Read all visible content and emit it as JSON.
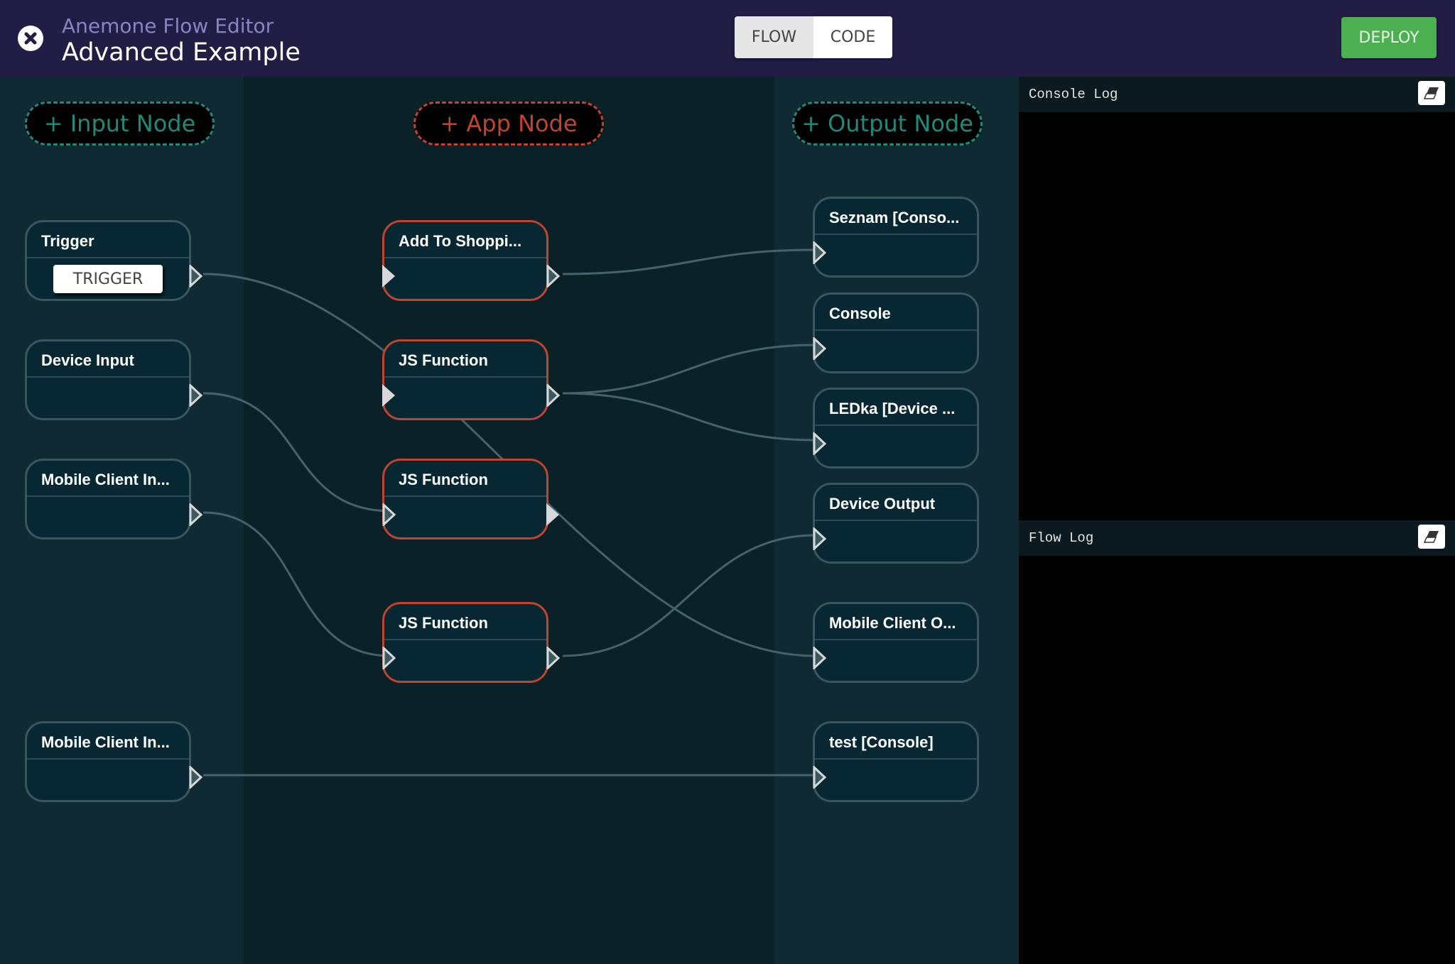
{
  "header": {
    "app_name": "Anemone Flow Editor",
    "flow_title": "Advanced Example",
    "close_icon": "close-circle-icon",
    "view_toggle": [
      {
        "label": "FLOW",
        "active": true
      },
      {
        "label": "CODE",
        "active": false
      }
    ],
    "deploy_label": "DEPLOY"
  },
  "colors": {
    "header_bg": "#221d45",
    "input_accent": "#1f8a7a",
    "app_accent": "#c0442e",
    "deploy_green": "#4caf50"
  },
  "columns": {
    "input": {
      "add_label": "+ Input Node",
      "nodes": [
        {
          "id": "trigger",
          "title": "Trigger",
          "button": "TRIGGER"
        },
        {
          "id": "device-input",
          "title": "Device Input"
        },
        {
          "id": "mobile-in-1",
          "title": "Mobile Client In..."
        },
        {
          "id": "mobile-in-2",
          "title": "Mobile Client In..."
        }
      ]
    },
    "app": {
      "add_label": "+ App Node",
      "nodes": [
        {
          "id": "add-to-shopping",
          "title": "Add To Shoppi..."
        },
        {
          "id": "js-1",
          "title": "JS Function"
        },
        {
          "id": "js-2",
          "title": "JS Function"
        },
        {
          "id": "js-3",
          "title": "JS Function"
        }
      ]
    },
    "output": {
      "add_label": "+ Output Node",
      "nodes": [
        {
          "id": "seznam",
          "title": "Seznam [Conso..."
        },
        {
          "id": "console",
          "title": "Console"
        },
        {
          "id": "ledka",
          "title": "LEDka [Device ..."
        },
        {
          "id": "device-output",
          "title": "Device Output"
        },
        {
          "id": "mobile-out",
          "title": "Mobile Client O..."
        },
        {
          "id": "test-console",
          "title": "test [Console]"
        }
      ]
    }
  },
  "connections": [
    {
      "from": "trigger",
      "to": "mobile-out"
    },
    {
      "from": "device-input",
      "to": "js-2"
    },
    {
      "from": "mobile-in-1",
      "to": "js-3"
    },
    {
      "from": "mobile-in-2",
      "to": "test-console"
    },
    {
      "from": "add-to-shopping",
      "to": "seznam"
    },
    {
      "from": "js-1",
      "to": "console"
    },
    {
      "from": "js-1",
      "to": "ledka"
    },
    {
      "from": "js-3",
      "to": "device-output"
    }
  ],
  "logs": {
    "console_log": {
      "label": "Console Log",
      "clear_icon": "eraser-icon"
    },
    "flow_log": {
      "label": "Flow Log",
      "clear_icon": "eraser-icon"
    }
  }
}
